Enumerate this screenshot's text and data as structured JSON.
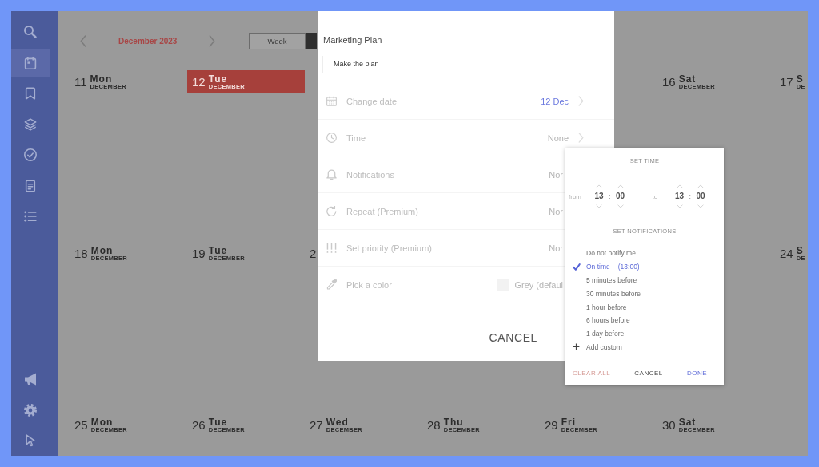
{
  "sidebar": {
    "top_items": [
      {
        "selected": false
      },
      {
        "selected": true
      },
      {
        "selected": false
      },
      {
        "selected": false
      },
      {
        "selected": false
      },
      {
        "selected": false
      },
      {
        "selected": false
      }
    ],
    "bottom_items": [
      {
        "selected": false
      },
      {
        "selected": false
      },
      {
        "selected": false
      }
    ]
  },
  "calendar": {
    "header": {
      "month": "December 2023",
      "view_tabs": [
        {
          "label": "Week",
          "selected": false
        },
        {
          "selected": true
        }
      ]
    },
    "weeks": [
      {
        "column_1": {
          "day": "11",
          "weekday": "Mon",
          "month": "DECEMBER",
          "today": false
        },
        "column_2": {
          "day": "12",
          "weekday": "Tue",
          "month": "DECEMBER",
          "today": true
        },
        "column_6": {
          "day": "16",
          "weekday": "Sat",
          "month": "DECEMBER",
          "today": false
        },
        "column_7": {
          "day": "17",
          "weekday": "S",
          "month": "DE",
          "today": false
        }
      },
      {
        "column_1": {
          "day": "18",
          "weekday": "Mon",
          "month": "DECEMBER",
          "today": false
        },
        "column_2": {
          "day": "19",
          "weekday": "Tue",
          "month": "DECEMBER",
          "today": false
        },
        "column_3": {
          "day": "2",
          "today": false
        },
        "column_7": {
          "day": "24",
          "weekday": "S",
          "month": "DE",
          "today": false
        }
      },
      {
        "column_1": {
          "day": "25",
          "weekday": "Mon",
          "month": "DECEMBER",
          "today": false
        },
        "column_2": {
          "day": "26",
          "weekday": "Tue",
          "month": "DECEMBER",
          "today": false
        },
        "column_3": {
          "day": "27",
          "weekday": "Wed",
          "month": "DECEMBER",
          "today": false
        },
        "column_4": {
          "day": "28",
          "weekday": "Thu",
          "month": "DECEMBER",
          "today": false
        },
        "column_5": {
          "day": "29",
          "weekday": "Fri",
          "month": "DECEMBER",
          "today": false
        },
        "column_6": {
          "day": "30",
          "weekday": "Sat",
          "month": "DECEMBER",
          "today": false
        }
      }
    ]
  },
  "event_dialog": {
    "title": "Marketing Plan",
    "description": "Make the plan",
    "options": [
      {
        "label": "Change date",
        "value": "12 Dec",
        "kind": "link",
        "highlighted": true
      },
      {
        "label": "Time",
        "value": "None",
        "kind": "link",
        "highlighted": false
      },
      {
        "label": "Notifications",
        "value": "Nor",
        "kind": "text",
        "highlighted": false
      },
      {
        "label": "Repeat (Premium)",
        "value": "Nor",
        "kind": "text",
        "highlighted": false
      },
      {
        "label": "Set priority (Premium)",
        "value": "Nor",
        "kind": "text",
        "highlighted": false
      },
      {
        "label": "Pick a color",
        "value": "Grey (defaul",
        "kind": "color",
        "highlighted": false
      }
    ],
    "buttons": [
      {
        "label": "CANCEL"
      }
    ]
  },
  "time_popup": {
    "title": "SET TIME",
    "from": {
      "label": "from",
      "hour": "13",
      "separator": ":",
      "minute": "00"
    },
    "to": {
      "label": "to",
      "hour": "13",
      "separator": ":",
      "minute": "00"
    },
    "notifications_title": "SET NOTIFICATIONS",
    "notifications": [
      {
        "label": "Do not notify me",
        "selected": false
      },
      {
        "label": "On time",
        "time": "(13:00)",
        "selected": true
      },
      {
        "label": "5 minutes before",
        "selected": false
      },
      {
        "label": "30 minutes before",
        "selected": false
      },
      {
        "label": "1 hour before",
        "selected": false
      },
      {
        "label": "6 hours before",
        "selected": false
      },
      {
        "label": "1 day before",
        "selected": false
      }
    ],
    "add_custom": "Add custom",
    "buttons": [
      {
        "label": "CLEAR ALL",
        "kind": "danger",
        "disabled": true
      },
      {
        "label": "CANCEL",
        "kind": "neutral",
        "disabled": false
      },
      {
        "label": "DONE",
        "kind": "primary",
        "disabled": false
      }
    ]
  }
}
